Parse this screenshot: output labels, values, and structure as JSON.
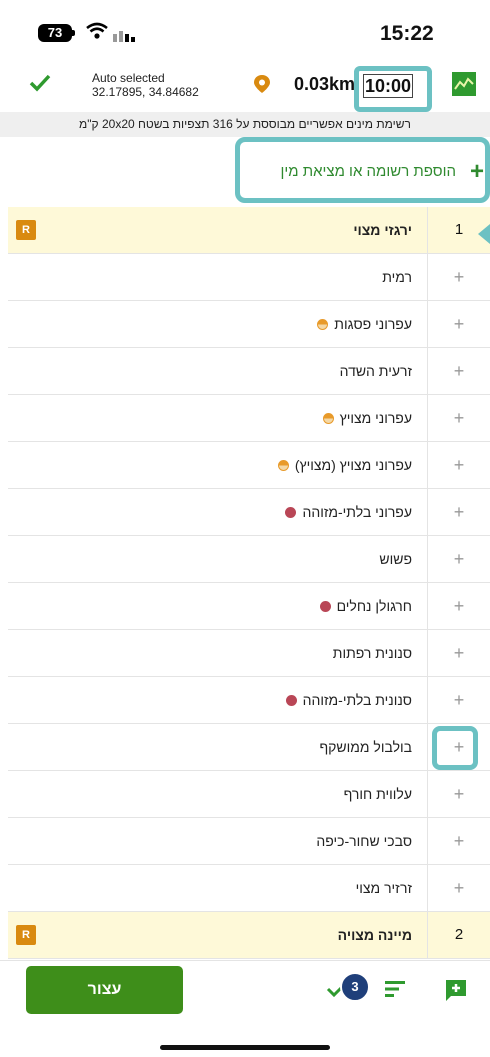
{
  "status_bar": {
    "battery": "73",
    "time": "15:22"
  },
  "toolbar": {
    "auto_label": "Auto selected",
    "coordinates": "32.17895, 34.84682",
    "distance": "0.03km",
    "timer": "10:00"
  },
  "info_bar": {
    "text": "רשימת מינים אפשריים מבוססת על 316 תצפיות בשטח 20x20 ק\"מ"
  },
  "add_button": {
    "label": "הוספת רשומה או מציאת מין",
    "icon": "plus-icon"
  },
  "list": {
    "groups": [
      {
        "number": "1",
        "name": "ירגזי מצוי",
        "badge": "R"
      },
      {
        "number": "2",
        "name": "מיינה מצויה",
        "badge": "R"
      }
    ],
    "species": [
      {
        "name": "רמית",
        "marker": ""
      },
      {
        "name": "עפרוני פסגות",
        "marker": "half"
      },
      {
        "name": "זרעית השדה",
        "marker": ""
      },
      {
        "name": "עפרוני מצויץ",
        "marker": "half"
      },
      {
        "name": "עפרוני מצויץ (מצויץ)",
        "marker": "half"
      },
      {
        "name": "עפרוני בלתי-מזוהה",
        "marker": "red"
      },
      {
        "name": "פשוש",
        "marker": ""
      },
      {
        "name": "חרגולן נחלים",
        "marker": "red"
      },
      {
        "name": "סנונית רפתות",
        "marker": ""
      },
      {
        "name": "סנונית בלתי-מזוהה",
        "marker": "red"
      },
      {
        "name": "בולבול ממושקף",
        "marker": ""
      },
      {
        "name": "עלווית חורף",
        "marker": ""
      },
      {
        "name": "סבכי שחור-כיפה",
        "marker": ""
      },
      {
        "name": "זרזיר מצוי",
        "marker": ""
      }
    ]
  },
  "bottom_bar": {
    "stop_label": "עצור",
    "done_count": "3"
  },
  "colors": {
    "accent_green": "#3e8e1a",
    "highlight": "#6cc1c3",
    "group_bg": "#fef9d8",
    "badge": "#d98a10",
    "marker_red": "#b94656",
    "marker_orange": "#e89a2a"
  }
}
